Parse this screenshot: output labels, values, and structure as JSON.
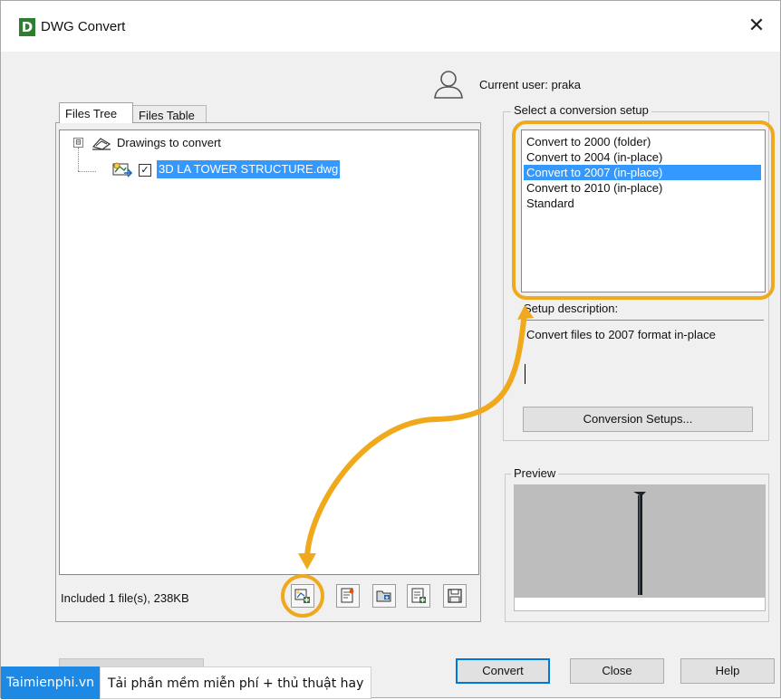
{
  "window": {
    "logo_letter": "D",
    "title": "DWG Convert",
    "close_glyph": "✕"
  },
  "user": {
    "label": "Current user: praka",
    "icon": "user-icon"
  },
  "tabs": [
    {
      "label": "Files Tree",
      "active": true
    },
    {
      "label": "Files Table",
      "active": false
    }
  ],
  "tree": {
    "root_label": "Drawings to convert",
    "expander": "⊟",
    "files": [
      {
        "name": "3D LA TOWER STRUCTURE.dwg",
        "checked": true
      }
    ]
  },
  "status": "Included 1 file(s), 238KB",
  "toolbar": [
    {
      "name": "add-file-icon",
      "highlighted": true
    },
    {
      "name": "properties-icon"
    },
    {
      "name": "open-folder-icon"
    },
    {
      "name": "list-add-icon"
    },
    {
      "name": "save-icon"
    }
  ],
  "setup": {
    "group_label": "Select a conversion setup",
    "items": [
      {
        "label": "Convert to 2000 (folder)",
        "selected": false
      },
      {
        "label": "Convert to 2004 (in-place)",
        "selected": false
      },
      {
        "label": "Convert to 2007 (in-place)",
        "selected": true
      },
      {
        "label": "Convert to 2010 (in-place)",
        "selected": false
      },
      {
        "label": "Standard",
        "selected": false
      }
    ],
    "description_label": "Setup description:",
    "description": "Convert files to 2007 format in-place",
    "setups_button": "Conversion Setups..."
  },
  "preview": {
    "label": "Preview"
  },
  "buttons": {
    "convert": "Convert",
    "close": "Close",
    "help": "Help"
  },
  "watermark": {
    "brand": "Taimienphi.vn",
    "tagline": "Tải phần mềm miễn phí + thủ thuật hay"
  },
  "colors": {
    "selection": "#3399ff",
    "annotation": "#f0a81c"
  }
}
